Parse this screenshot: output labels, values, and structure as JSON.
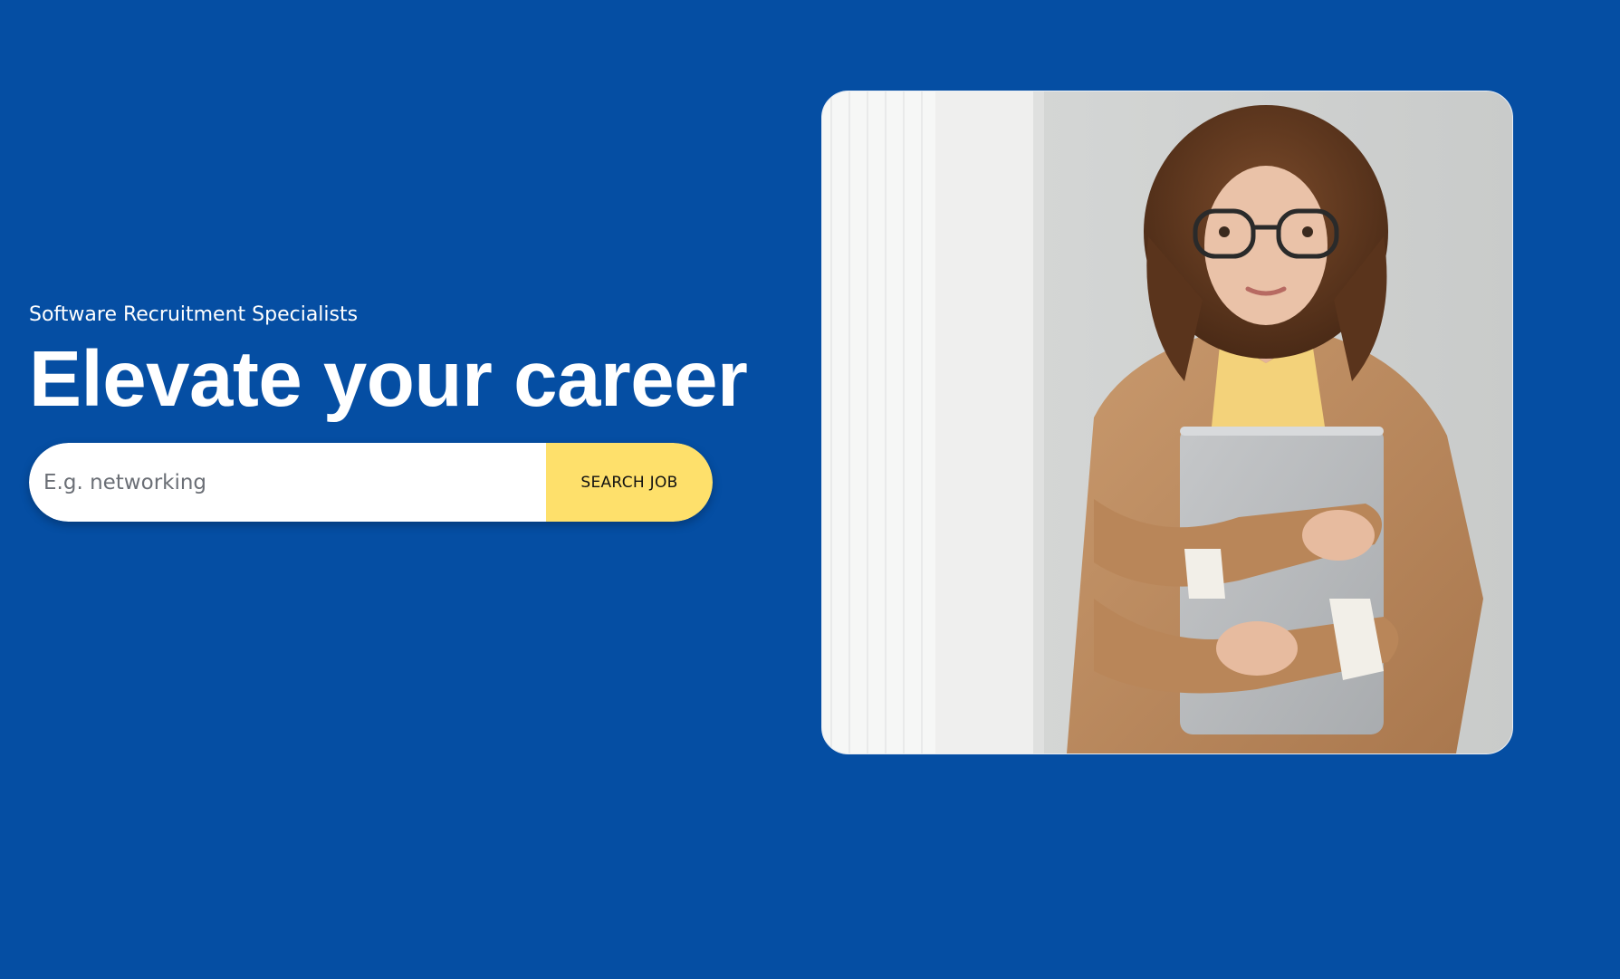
{
  "hero": {
    "eyebrow": "Software Recruitment Specialists",
    "headline": "Elevate your career",
    "search": {
      "placeholder": "E.g. networking",
      "value": "",
      "button_label": "SEARCH JOB"
    },
    "image": {
      "alt": "Woman with curly hair and glasses holding a laptop"
    }
  },
  "colors": {
    "background": "#054ea3",
    "accent": "#fee06b",
    "text": "#ffffff"
  }
}
